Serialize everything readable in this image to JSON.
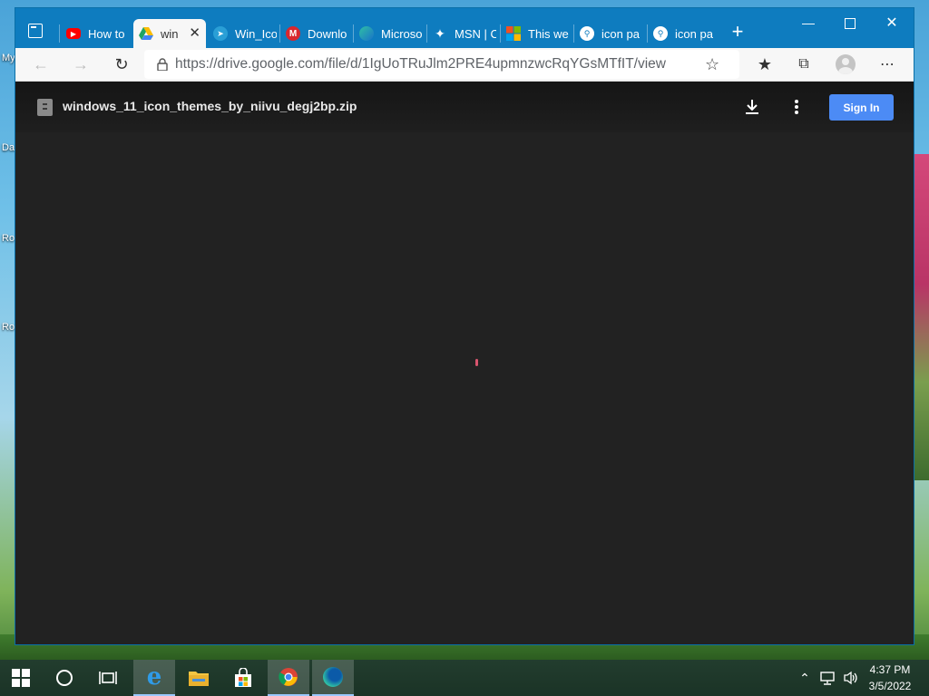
{
  "desktop": {
    "icon_labels": [
      "My",
      "Da",
      "Ro",
      "Ro"
    ]
  },
  "browser": {
    "tabs": [
      {
        "label": "How to",
        "icon": "youtube-icon",
        "color": "#ff0000"
      },
      {
        "label": "win",
        "icon": "google-drive-icon",
        "color": "#1fa463",
        "active": true
      },
      {
        "label": "Win_Ico",
        "icon": "telegram-icon",
        "color": "#2a9fd6"
      },
      {
        "label": "Downlo",
        "icon": "mega-icon",
        "color": "#d9272e"
      },
      {
        "label": "Microso",
        "icon": "edge-icon",
        "color": "#2fbfa5"
      },
      {
        "label": "MSN | C",
        "icon": "msn-icon",
        "color": "#ffffff"
      },
      {
        "label": "This we",
        "icon": "microsoft-icon",
        "color": "#f25022"
      },
      {
        "label": "icon pa",
        "icon": "bing-search-icon",
        "color": "#ffffff"
      },
      {
        "label": "icon pa",
        "icon": "bing-search-icon",
        "color": "#ffffff"
      }
    ],
    "url": "https://drive.google.com/file/d/1IgUoTRuJlm2PRE4upmnzwcRqYGsMTfIT/view"
  },
  "viewer": {
    "file_name": "windows_11_icon_themes_by_niivu_degj2bp.zip",
    "sign_in_label": "Sign In"
  },
  "taskbar": {
    "time": "4:37 PM",
    "date": "3/5/2022"
  },
  "colors": {
    "titlebar": "#0e7cbf",
    "viewer_bg": "#222222",
    "sign_in": "#4c8bf5"
  }
}
